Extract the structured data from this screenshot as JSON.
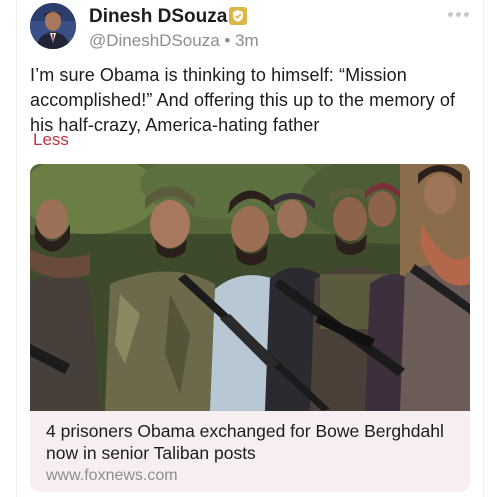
{
  "post": {
    "author_name": "Dinesh DSouza",
    "handle": "@DineshDSouza",
    "separator": "•",
    "time": "3m",
    "verified_icon": "shield-badge-icon",
    "more_icon": "more-dots-icon",
    "text": "I’m sure Obama is thinking to himself: “Mission accomplished!” And offering this up to the memory of his half-crazy, America-hating father",
    "less_label": "Less",
    "accent_color": "#c1343f"
  },
  "link_preview": {
    "title": "4 prisoners Obama exchanged for Bowe Berghdahl now in senior Taliban posts",
    "domain": "www.foxnews.com",
    "background_color": "#f7eef1"
  }
}
